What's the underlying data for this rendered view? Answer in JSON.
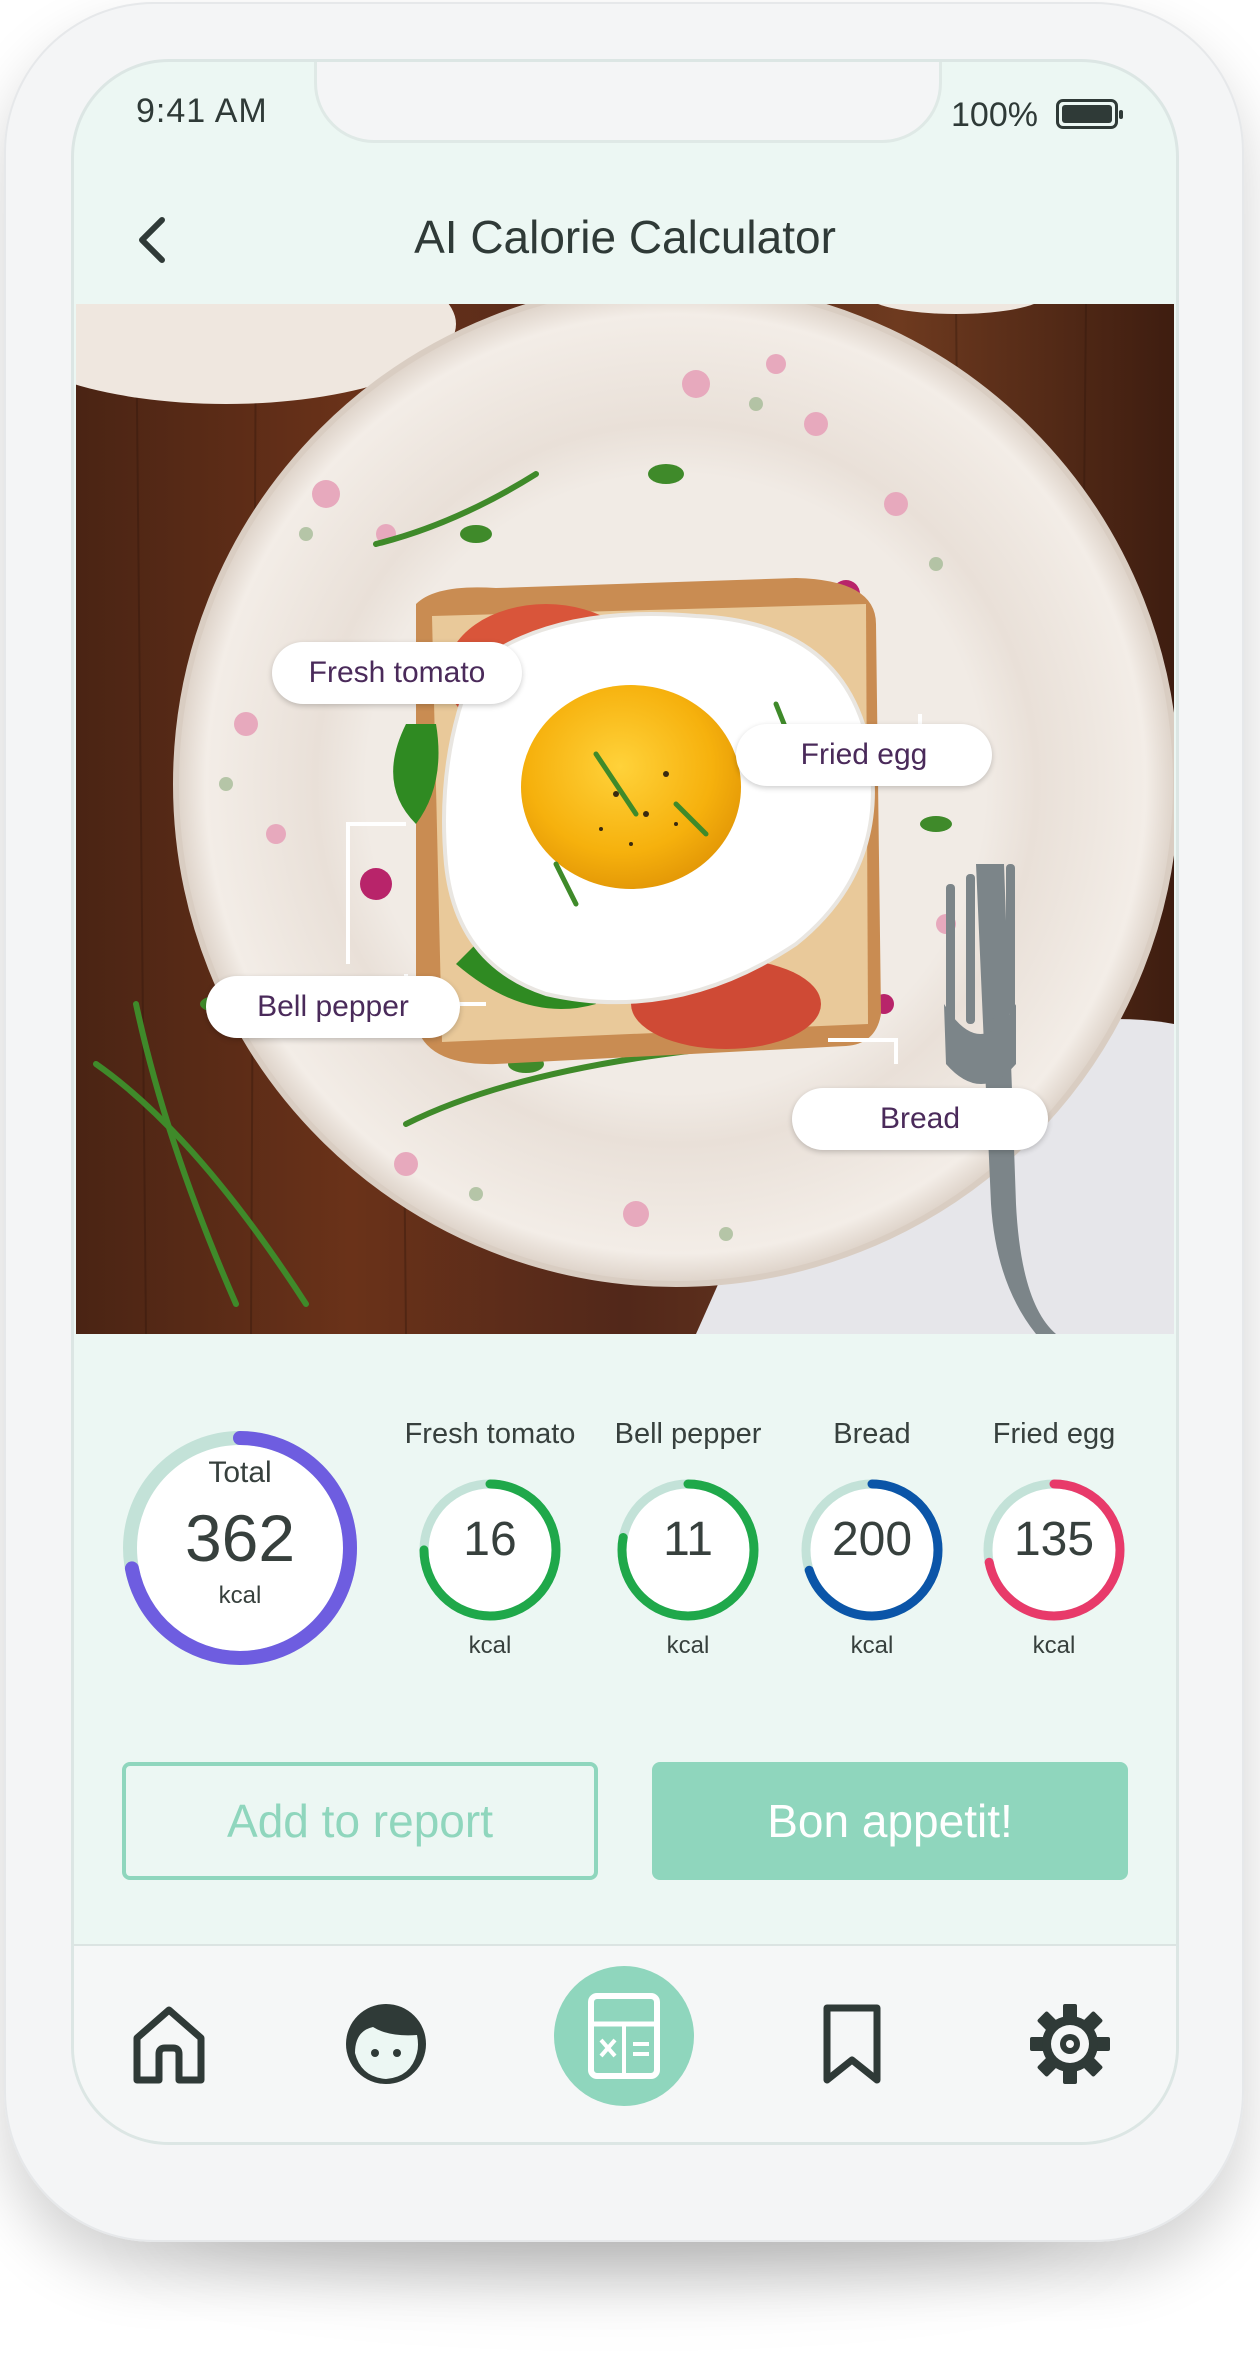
{
  "status": {
    "time": "9:41 AM",
    "battery": "100%"
  },
  "header": {
    "title": "AI Calorie Calculator"
  },
  "photo_tags": {
    "fresh_tomato": "Fresh tomato",
    "fried_egg": "Fried egg",
    "bell_pepper": "Bell pepper",
    "bread": "Bread"
  },
  "total": {
    "label": "Total",
    "value": "362",
    "unit": "kcal",
    "color": "#6e5de0"
  },
  "items": [
    {
      "label": "Fresh tomato",
      "value": "16",
      "unit": "kcal",
      "color": "#1fa84a",
      "fraction": 0.75
    },
    {
      "label": "Bell pepper",
      "value": "11",
      "unit": "kcal",
      "color": "#1fa84a",
      "fraction": 0.78
    },
    {
      "label": "Bread",
      "value": "200",
      "unit": "kcal",
      "color": "#0b55a8",
      "fraction": 0.7
    },
    {
      "label": "Fried egg",
      "value": "135",
      "unit": "kcal",
      "color": "#e83a6a",
      "fraction": 0.72
    }
  ],
  "actions": {
    "add_to_report": "Add to report",
    "bon_appetit": "Bon appetit!"
  },
  "nav": [
    "home-icon",
    "profile-face-icon",
    "calculator-icon",
    "bookmark-icon",
    "settings-gear-icon"
  ],
  "colors": {
    "accent": "#8fd6bd",
    "background": "#ecf7f3",
    "icon": "#2f3a37"
  }
}
